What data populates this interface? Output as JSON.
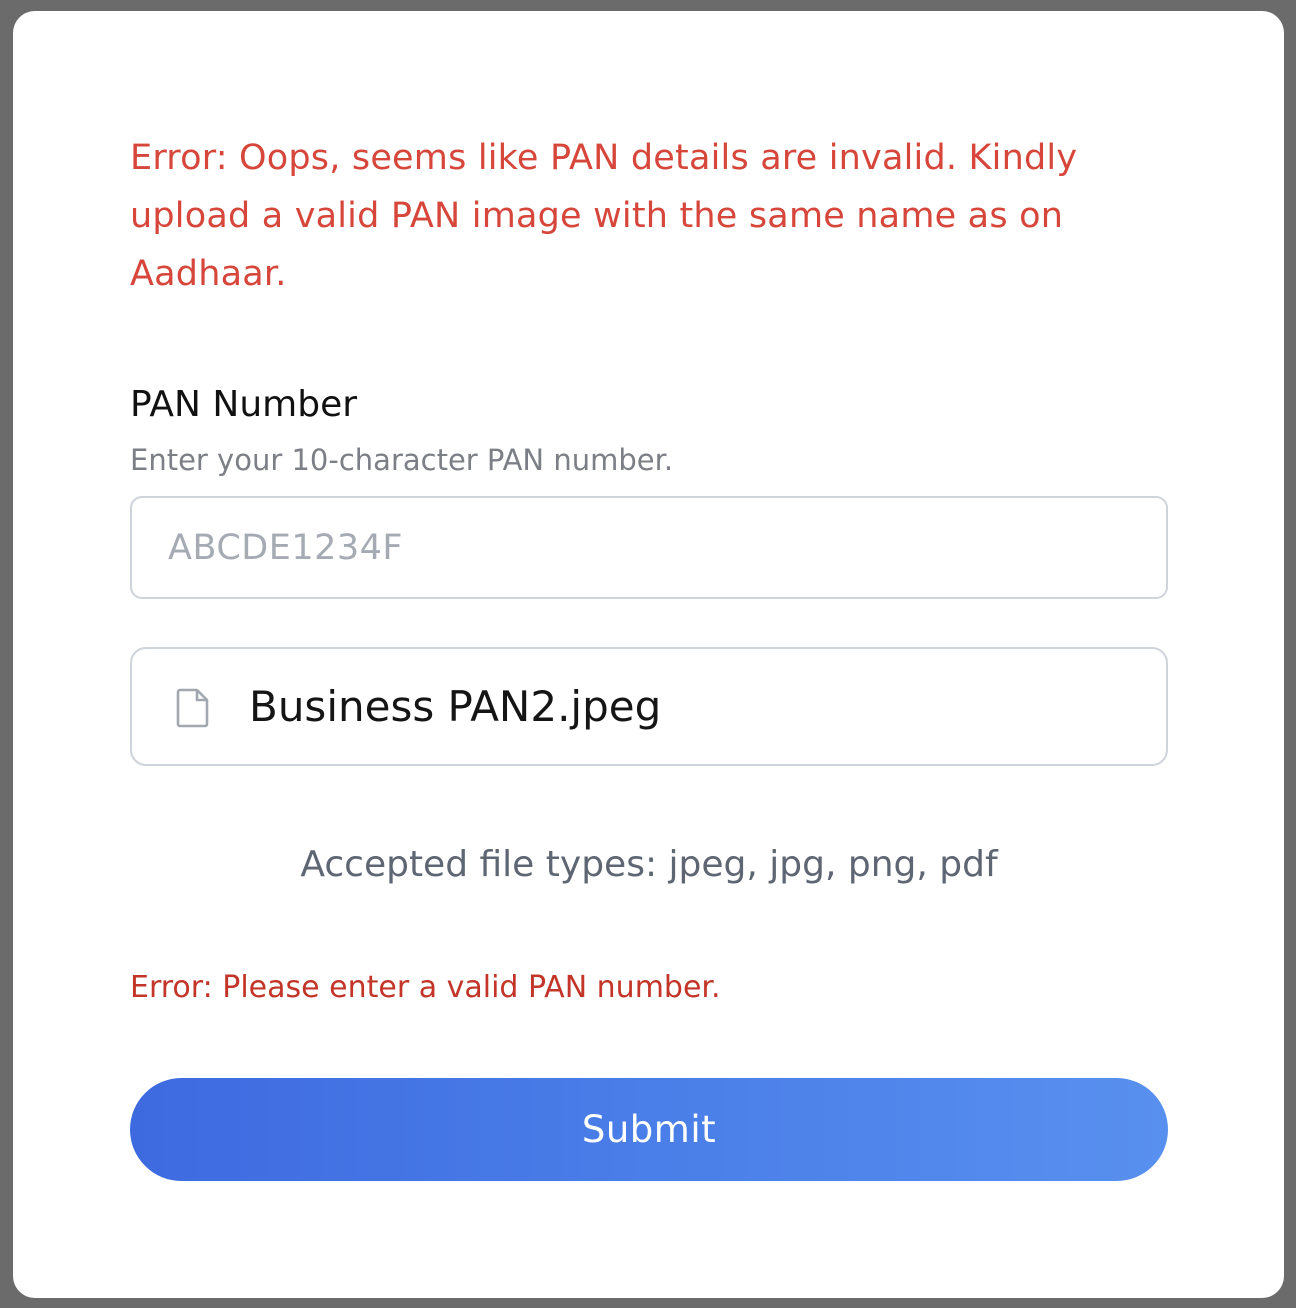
{
  "form": {
    "top_error": "Error: Oops, seems like PAN details are invalid. Kindly upload a valid PAN image with the same name as on Aadhaar.",
    "pan_label": "PAN Number",
    "pan_help": "Enter your 10-character PAN number.",
    "pan_input": {
      "value": "",
      "placeholder": "ABCDE1234F"
    },
    "file": {
      "icon": "file-icon",
      "name": "Business PAN2.jpeg"
    },
    "accepted_types": "Accepted file types: jpeg, jpg, png, pdf",
    "bottom_error": "Error: Please enter a valid PAN number.",
    "submit_label": "Submit"
  },
  "colors": {
    "error": "#d6463a",
    "error_dark": "#c33528",
    "button_start": "#3e6ae0",
    "button_end": "#5890ef",
    "border": "#cfd3da"
  }
}
